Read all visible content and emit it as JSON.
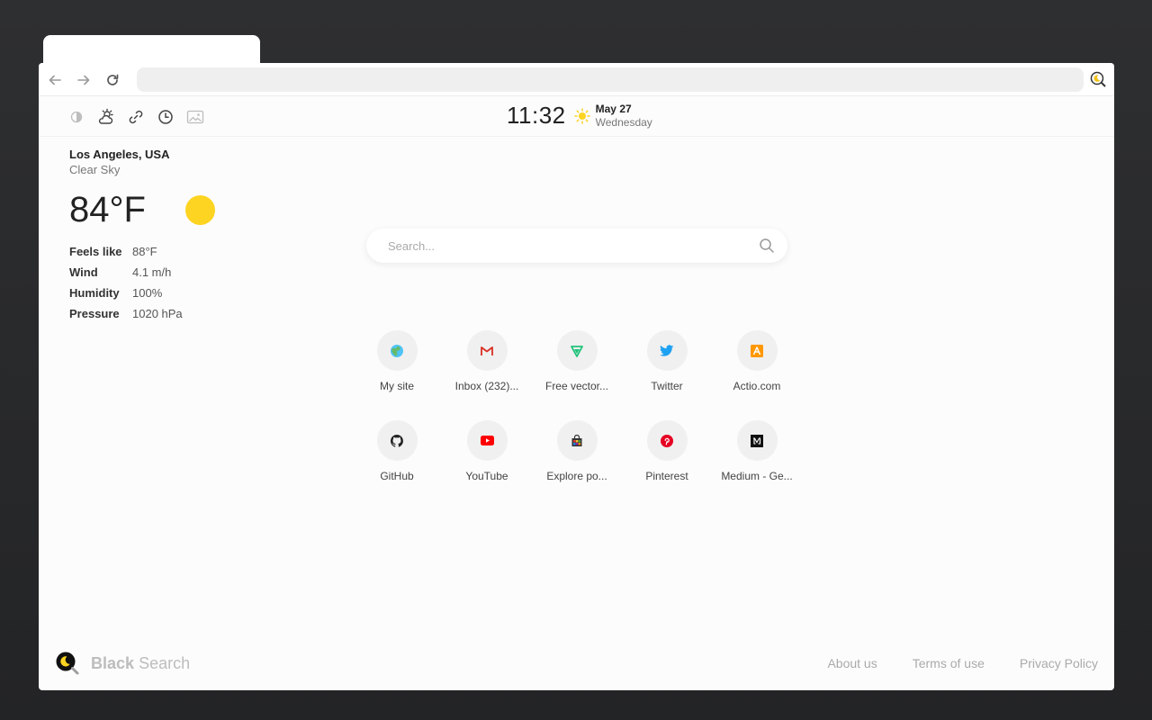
{
  "topbar": {
    "time": "11:32",
    "date": "May 27",
    "weekday": "Wednesday",
    "tools": [
      "contrast-icon",
      "weather-icon",
      "link-icon",
      "clock-icon",
      "image-icon"
    ]
  },
  "weather": {
    "location": "Los Angeles, USA",
    "condition": "Clear Sky",
    "temperature": "84°F",
    "details": [
      {
        "label": "Feels like",
        "value": "88°F"
      },
      {
        "label": "Wind",
        "value": "4.1 m/h"
      },
      {
        "label": "Humidity",
        "value": "100%"
      },
      {
        "label": "Pressure",
        "value": "1020 hPa"
      }
    ]
  },
  "search": {
    "placeholder": "Search..."
  },
  "shortcuts": [
    {
      "label": "My site",
      "icon": "globe-icon"
    },
    {
      "label": "Inbox (232)...",
      "icon": "gmail-icon"
    },
    {
      "label": "Free vector...",
      "icon": "vector-icon"
    },
    {
      "label": "Twitter",
      "icon": "twitter-icon"
    },
    {
      "label": "Actio.com",
      "icon": "actio-icon"
    },
    {
      "label": "GitHub",
      "icon": "github-icon"
    },
    {
      "label": "YouTube",
      "icon": "youtube-icon"
    },
    {
      "label": "Explore po...",
      "icon": "shop-icon"
    },
    {
      "label": "Pinterest",
      "icon": "pinterest-icon"
    },
    {
      "label": "Medium - Ge...",
      "icon": "medium-icon"
    }
  ],
  "footer": {
    "brand_bold": "Black",
    "brand_rest": "Search",
    "links": [
      "About us",
      "Terms of use",
      "Privacy Policy"
    ]
  },
  "colors": {
    "sun": "#fdd421",
    "background": "#fcfcfc",
    "frame": "#2a2b2d"
  }
}
